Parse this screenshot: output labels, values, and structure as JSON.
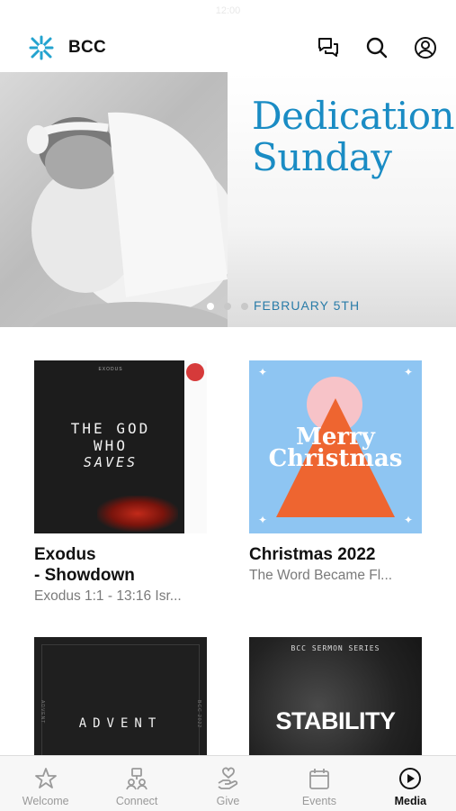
{
  "status": {
    "time": "12:00"
  },
  "header": {
    "title": "BCC",
    "icons": [
      "chat-icon",
      "search-icon",
      "profile-icon"
    ]
  },
  "hero": {
    "title_line1": "Dedication",
    "title_line2": "Sunday",
    "date": "FEBRUARY 5TH",
    "slides": 3,
    "active_slide": 1
  },
  "cards": [
    {
      "title": "Exodus\n- Showdown",
      "subtitle": "Exodus 1:1 - 13:16 Isr...",
      "art": {
        "small": "EXODUS",
        "line1": "THE GOD",
        "line2": "WHO",
        "line3": "SAVES"
      }
    },
    {
      "title": "Christmas 2022",
      "subtitle": "The Word Became Fl...",
      "art": {
        "line1": "Merry",
        "line2": "Christmas"
      }
    },
    {
      "title": "",
      "subtitle": "",
      "art": {
        "text": "ADVENT",
        "side_left": "ADVENT",
        "side_right": "BCC 2022"
      }
    },
    {
      "title": "",
      "subtitle": "",
      "art": {
        "top": "BCC SERMON SERIES",
        "text": "STABILITY"
      }
    }
  ],
  "tabs": [
    {
      "label": "Welcome",
      "icon": "star-icon",
      "active": false
    },
    {
      "label": "Connect",
      "icon": "people-icon",
      "active": false
    },
    {
      "label": "Give",
      "icon": "give-icon",
      "active": false
    },
    {
      "label": "Events",
      "icon": "calendar-icon",
      "active": false
    },
    {
      "label": "Media",
      "icon": "play-icon",
      "active": true
    }
  ],
  "colors": {
    "accent": "#1a8cc4",
    "hero_date": "#2a7ca8",
    "christmas_bg": "#8ec5f2",
    "christmas_triangle": "#ee6530",
    "logo": "#23a3cf"
  }
}
